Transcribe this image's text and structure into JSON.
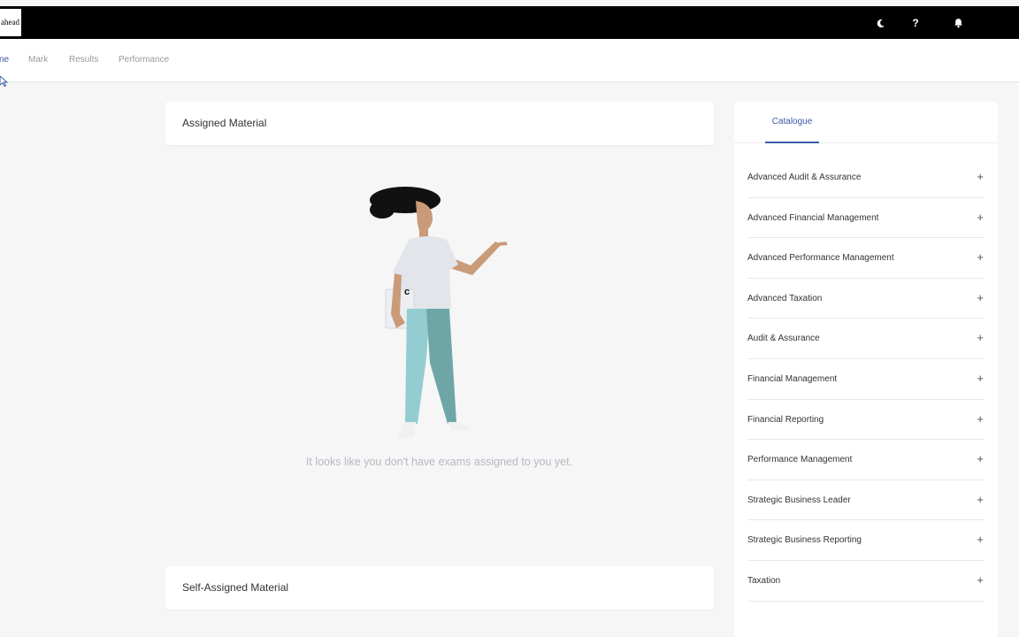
{
  "header": {
    "logo_text": "ahead",
    "icons": [
      "moon-icon",
      "help-icon",
      "bell-icon"
    ],
    "help_glyph": "?"
  },
  "nav": {
    "items": [
      {
        "label": "ne",
        "active": true
      },
      {
        "label": "Mark",
        "active": false
      },
      {
        "label": "Results",
        "active": false
      },
      {
        "label": "Performance",
        "active": false
      }
    ]
  },
  "assigned": {
    "title": "Assigned Material",
    "empty_message": "It looks like you don't have exams assigned to you yet."
  },
  "self_assigned": {
    "title": "Self-Assigned Material"
  },
  "catalogue": {
    "tab_label": "Catalogue",
    "items": [
      {
        "label": "Advanced Audit & Assurance"
      },
      {
        "label": "Advanced Financial Management"
      },
      {
        "label": "Advanced Performance Management"
      },
      {
        "label": "Advanced Taxation"
      },
      {
        "label": "Audit & Assurance"
      },
      {
        "label": "Financial Management"
      },
      {
        "label": "Financial Reporting"
      },
      {
        "label": "Performance Management"
      },
      {
        "label": "Strategic Business Leader"
      },
      {
        "label": "Strategic Business Reporting"
      },
      {
        "label": "Taxation"
      }
    ],
    "expand_glyph": "+"
  },
  "colors": {
    "accent": "#3d5aa8",
    "topbar": "#000000",
    "background": "#f6f6f6"
  }
}
